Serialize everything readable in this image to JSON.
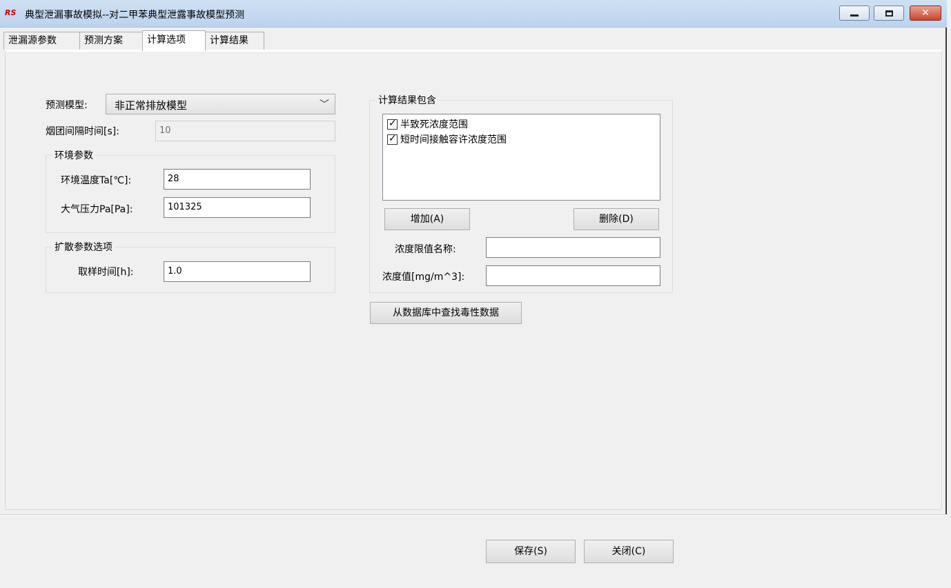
{
  "window": {
    "icon_text": "RS",
    "title": "典型泄漏事故模拟--对二甲苯典型泄露事故模型预测",
    "min_icon": "minimize-icon",
    "max_icon": "maximize-icon",
    "close_icon": "close-icon"
  },
  "tabs": [
    {
      "label": "泄漏源参数"
    },
    {
      "label": "预测方案"
    },
    {
      "label": "计算选项"
    },
    {
      "label": "计算结果"
    }
  ],
  "left": {
    "model_label": "预测模型:",
    "model_value": "非正常排放模型",
    "interval_label": "烟团间隔时间[s]:",
    "interval_value": "10",
    "env_group": "环境参数",
    "temp_label": "环境温度Ta[℃]:",
    "temp_value": "28",
    "pressure_label": "大气压力Pa[Pa]:",
    "pressure_value": "101325",
    "diffusion_group": "扩散参数选项",
    "sampling_label": "取样时间[h]:",
    "sampling_value": "1.0"
  },
  "right": {
    "result_group": "计算结果包含",
    "items": [
      {
        "label": "半致死浓度范围",
        "checked": true
      },
      {
        "label": "短时间接触容许浓度范围",
        "checked": true
      }
    ],
    "add_button": "增加(A)",
    "delete_button": "删除(D)",
    "limit_name_label": "浓度限值名称:",
    "limit_name_value": "",
    "conc_label": "浓度值[mg/m^3]:",
    "conc_value": "",
    "db_button": "从数据库中查找毒性数据"
  },
  "footer": {
    "save_button": "保存(S)",
    "close_button": "关闭(C)"
  }
}
